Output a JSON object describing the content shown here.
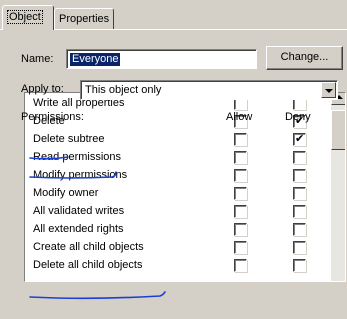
{
  "tabs": [
    {
      "label": "Object",
      "active": true
    },
    {
      "label": "Properties",
      "active": false
    }
  ],
  "name": {
    "label": "Name:",
    "value": "Everyone",
    "change_label": "Change..."
  },
  "apply_to": {
    "label": "Apply to:",
    "value": "This object only"
  },
  "permissions": {
    "label": "Permissions:",
    "allow_header": "Allow",
    "deny_header": "Deny",
    "rows": [
      {
        "label": "Write all properties",
        "allow": false,
        "deny": false
      },
      {
        "label": "Delete",
        "allow": false,
        "deny": true
      },
      {
        "label": "Delete subtree",
        "allow": false,
        "deny": true
      },
      {
        "label": "Read permissions",
        "allow": false,
        "deny": false
      },
      {
        "label": "Modify permissions",
        "allow": false,
        "deny": false
      },
      {
        "label": "Modify owner",
        "allow": false,
        "deny": false
      },
      {
        "label": "All validated writes",
        "allow": false,
        "deny": false
      },
      {
        "label": "All extended rights",
        "allow": false,
        "deny": false
      },
      {
        "label": "Create all child objects",
        "allow": false,
        "deny": false
      },
      {
        "label": "Delete all child objects",
        "allow": false,
        "deny": false
      }
    ]
  },
  "colors": {
    "dialog_bg": "#d4d0c8",
    "selection": "#0a246a",
    "ink_annotation": "#1a3fd6"
  }
}
